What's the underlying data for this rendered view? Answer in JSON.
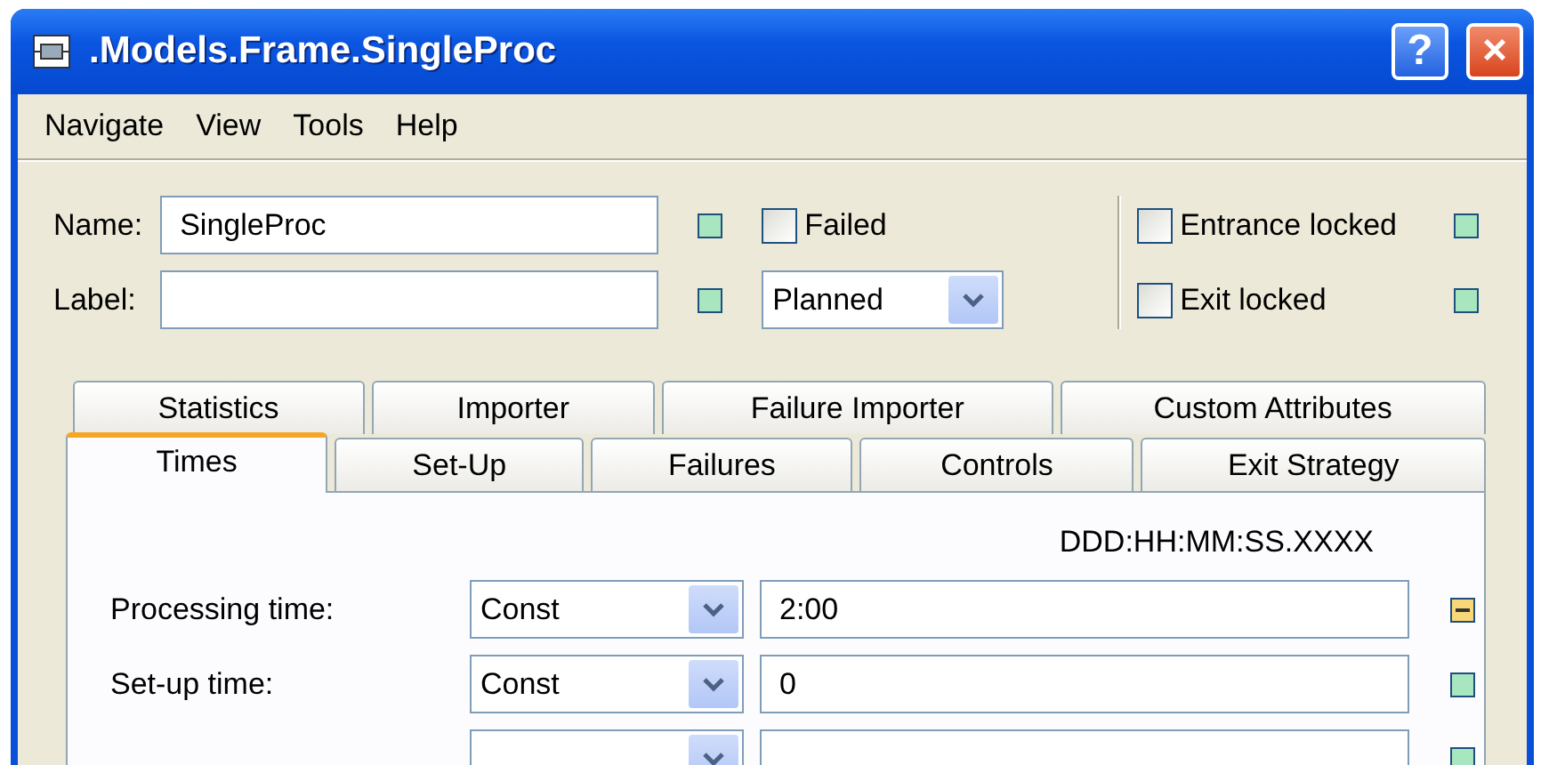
{
  "window": {
    "title": ".Models.Frame.SingleProc"
  },
  "title_buttons": [
    {
      "kind": "help",
      "label": "?"
    },
    {
      "kind": "close",
      "label": "×"
    }
  ],
  "menu": [
    "Navigate",
    "View",
    "Tools",
    "Help"
  ],
  "name": {
    "label": "Name:",
    "value": "SingleProc",
    "modified": false
  },
  "label_field": {
    "label": "Label:",
    "modified": false
  },
  "failed": {
    "label": "Failed",
    "checked": false
  },
  "failure_mode": {
    "value": "Planned"
  },
  "entrance_locked": {
    "label": "Entrance locked",
    "checked": false,
    "modified": false
  },
  "exit_locked": {
    "label": "Exit locked",
    "checked": false,
    "modified": false
  },
  "tab_rows": [
    [
      {
        "label": "Statistics",
        "selected": false
      },
      {
        "label": "Importer",
        "selected": false
      },
      {
        "label": "Failure Importer",
        "selected": false
      },
      {
        "label": "Custom Attributes",
        "selected": false
      }
    ],
    [
      {
        "label": "Times",
        "selected": true
      },
      {
        "label": "Set-Up",
        "selected": false
      },
      {
        "label": "Failures",
        "selected": false
      },
      {
        "label": "Controls",
        "selected": false
      },
      {
        "label": "Exit Strategy",
        "selected": false
      }
    ]
  ],
  "time_format": "DDD:HH:MM:SS.XXXX",
  "time_rows": [
    {
      "label": "Processing time:",
      "distribution": "Const",
      "value": "2:00",
      "modified": true
    },
    {
      "label": "Set-up time:",
      "distribution": "Const",
      "value": "0",
      "modified": false
    },
    {
      "modified": false
    }
  ]
}
